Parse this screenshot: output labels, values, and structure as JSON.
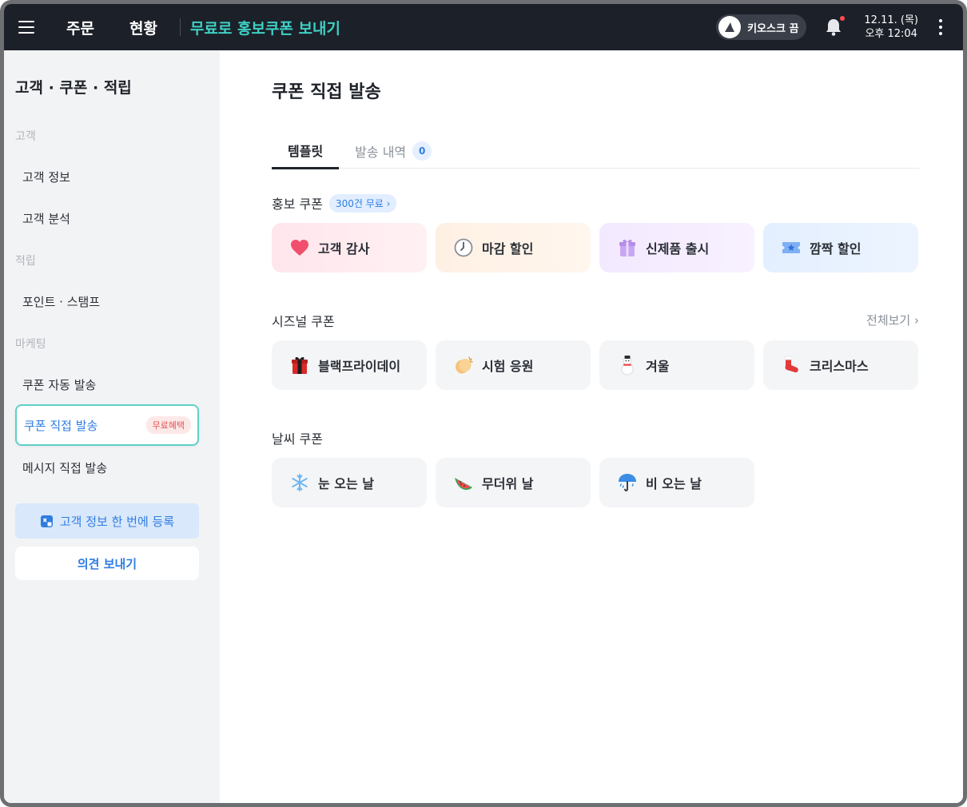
{
  "header": {
    "nav": [
      "주문",
      "현황"
    ],
    "promo": "무료로 홍보쿠폰 보내기",
    "kiosk_label": "키오스크 끔",
    "date": "12.11. (목)",
    "time": "오후 12:04"
  },
  "sidebar": {
    "title": "고객 · 쿠폰 · 적립",
    "sections": {
      "customer": "고객",
      "points": "적립",
      "marketing": "마케팅"
    },
    "items": {
      "customer_info": "고객 정보",
      "customer_analysis": "고객 분석",
      "point_stamp": "포인트 · 스탬프",
      "coupon_auto": "쿠폰 자동 발송",
      "coupon_direct": "쿠폰 직접 발송",
      "coupon_direct_badge": "무료혜택",
      "message_direct": "메시지 직접 발송"
    },
    "register_button": "고객 정보 한 번에 등록",
    "feedback_button": "의견 보내기"
  },
  "main": {
    "title": "쿠폰 직접 발송",
    "tabs": {
      "template": "템플릿",
      "history": "발송 내역",
      "history_count": "0"
    },
    "promo_section": {
      "label": "홍보 쿠폰",
      "badge": "300건 무료 ›",
      "cards": [
        "고객 감사",
        "마감 할인",
        "신제품 출시",
        "깜짝 할인"
      ]
    },
    "seasonal_section": {
      "label": "시즈널 쿠폰",
      "see_all": "전체보기 ›",
      "cards": [
        "블랙프라이데이",
        "시험 응원",
        "겨울",
        "크리스마스"
      ]
    },
    "weather_section": {
      "label": "날씨 쿠폰",
      "cards": [
        "눈 오는 날",
        "무더위 날",
        "비 오는 날"
      ]
    }
  },
  "colors": {
    "topbar": "#1c2029",
    "accent_teal": "#3fd0c4",
    "accent_blue": "#2f7de1",
    "sidebar_bg": "#f2f3f5"
  }
}
